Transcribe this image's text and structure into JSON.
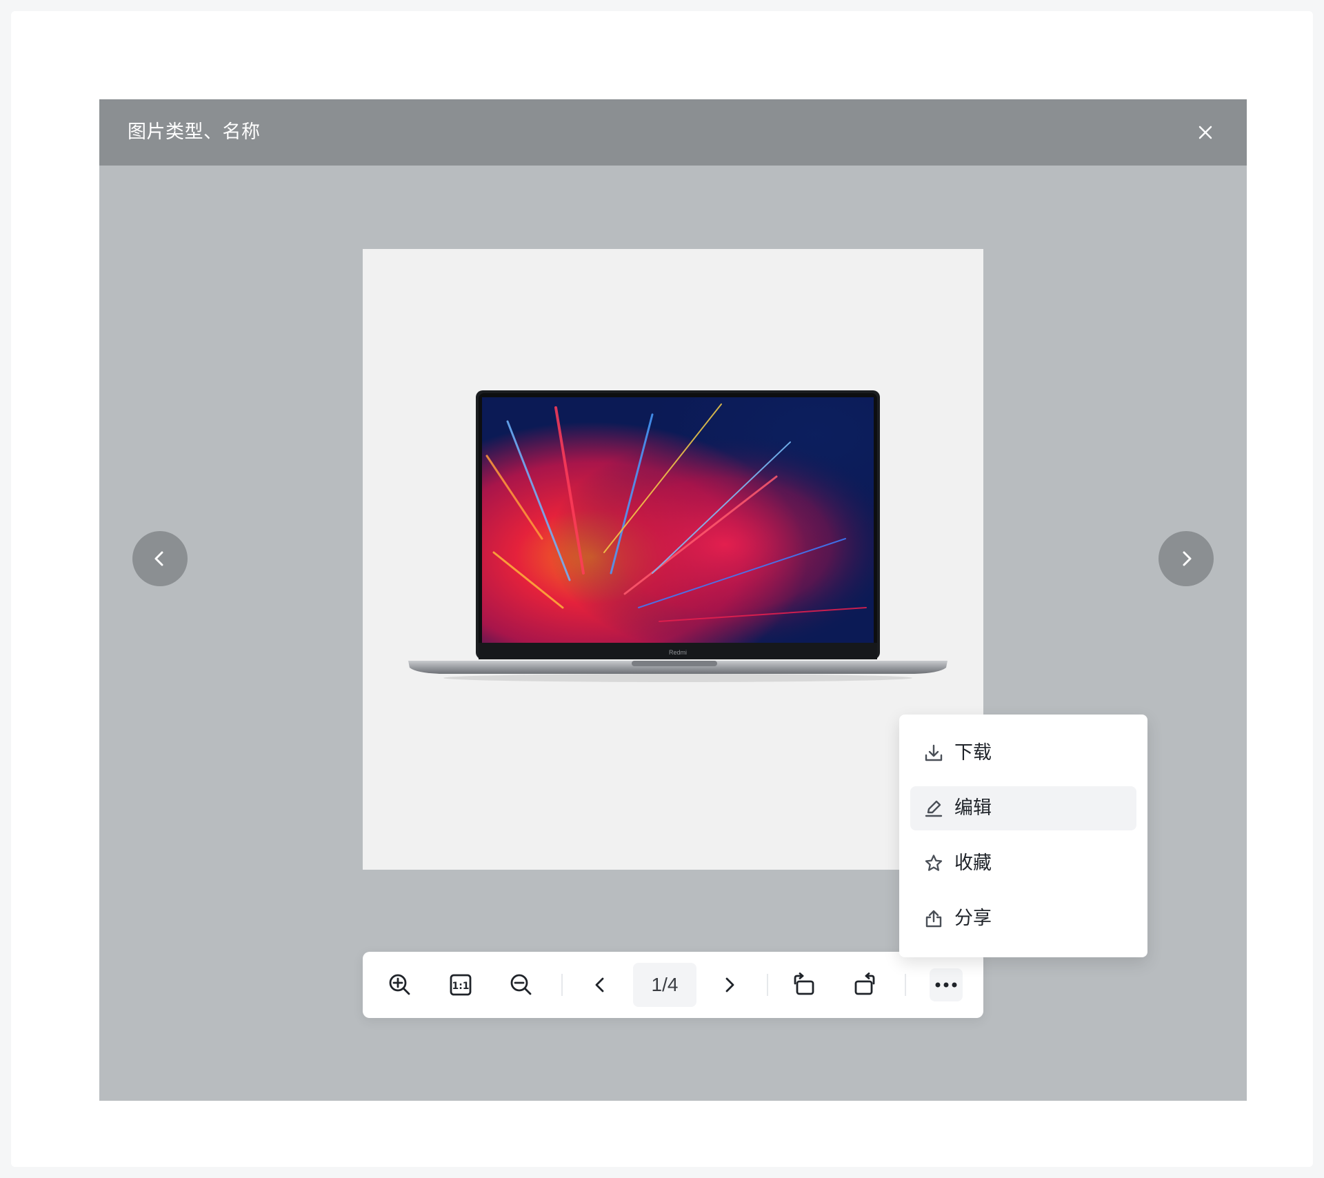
{
  "dialog": {
    "title": "图片类型、名称"
  },
  "toolbar": {
    "page_counter": "1/4",
    "buttons": [
      "zoom-in-icon",
      "actual-size-icon",
      "zoom-out-icon",
      "chevron-left-icon",
      "chevron-right-icon",
      "rotate-left-icon",
      "rotate-right-icon",
      "more-icon"
    ],
    "actual_size_glyph": "1:1"
  },
  "image": {
    "brand_text": "Redmi"
  },
  "more_menu": {
    "items": [
      {
        "label": "下载",
        "icon": "download-icon"
      },
      {
        "label": "编辑",
        "icon": "edit-icon",
        "active": true
      },
      {
        "label": "收藏",
        "icon": "star-icon"
      },
      {
        "label": "分享",
        "icon": "share-icon"
      }
    ]
  },
  "colors": {
    "header_bg": "#8b8f92",
    "body_bg": "#b8bcbf",
    "card_bg": "#f1f1f1",
    "menu_active_bg": "#f2f3f5"
  }
}
